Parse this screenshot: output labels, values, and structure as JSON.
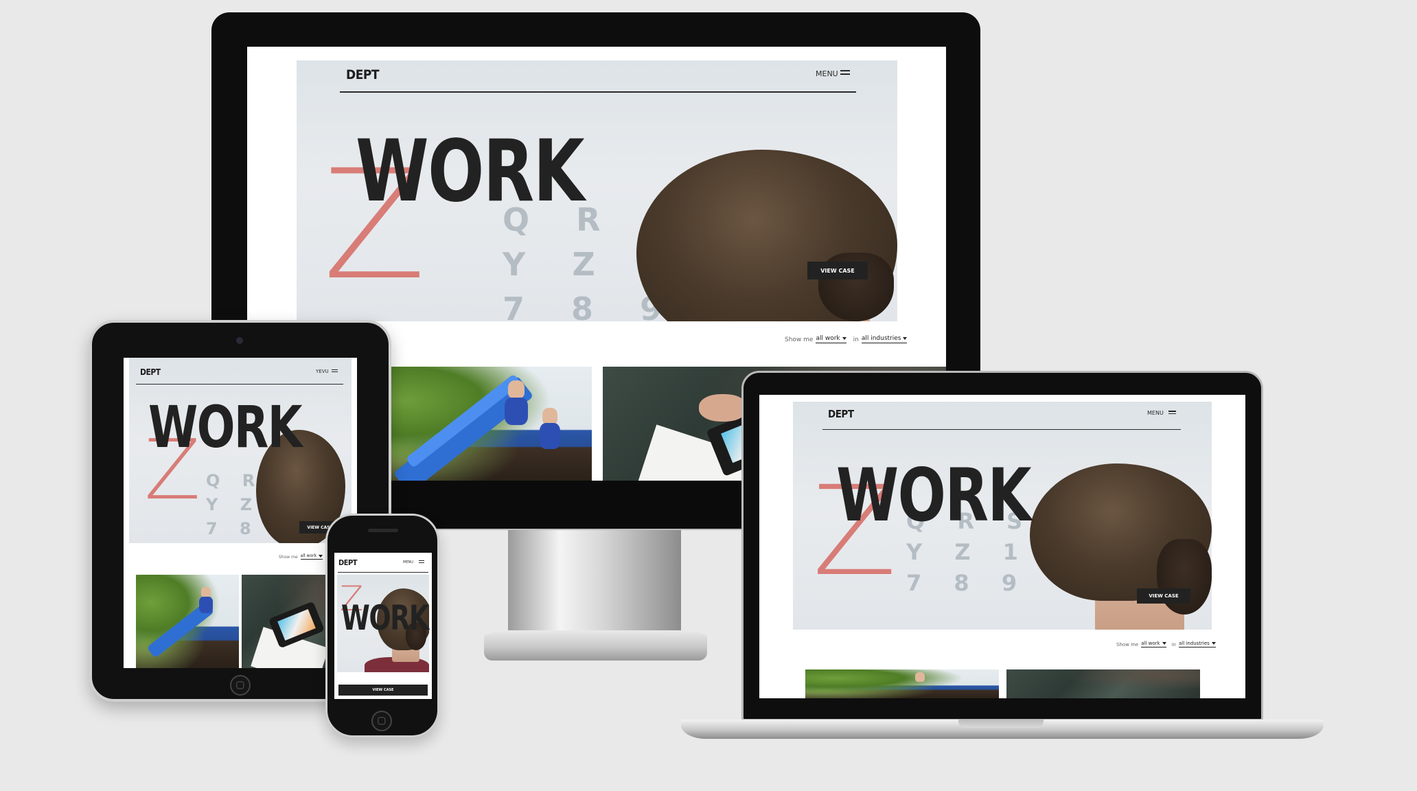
{
  "site": {
    "logo": "DEPT",
    "menu_label": "MENU",
    "tablet_menu_label": "YEVU",
    "hero_title": "WORK",
    "cta_label": "VIEW CASE",
    "filter": {
      "show_me_label": "Show me",
      "work_value": "all work",
      "in_label": "in",
      "industry_value": "all industries"
    },
    "eye_chart": {
      "big_letter": "Z",
      "row1": "Q R S",
      "row2": "Y Z 1",
      "row3": "7 8 9"
    }
  },
  "devices": [
    "desktop-monitor",
    "tablet",
    "smartphone",
    "laptop"
  ],
  "colors": {
    "background": "#e9e9e9",
    "ink": "#222222",
    "accent_red": "#d66a63",
    "frame_black": "#0d0d0d"
  },
  "icons": {
    "menu": "hamburger-icon",
    "dropdown": "caret-down-icon",
    "home_button": "home-button-icon",
    "camera": "camera-icon"
  }
}
